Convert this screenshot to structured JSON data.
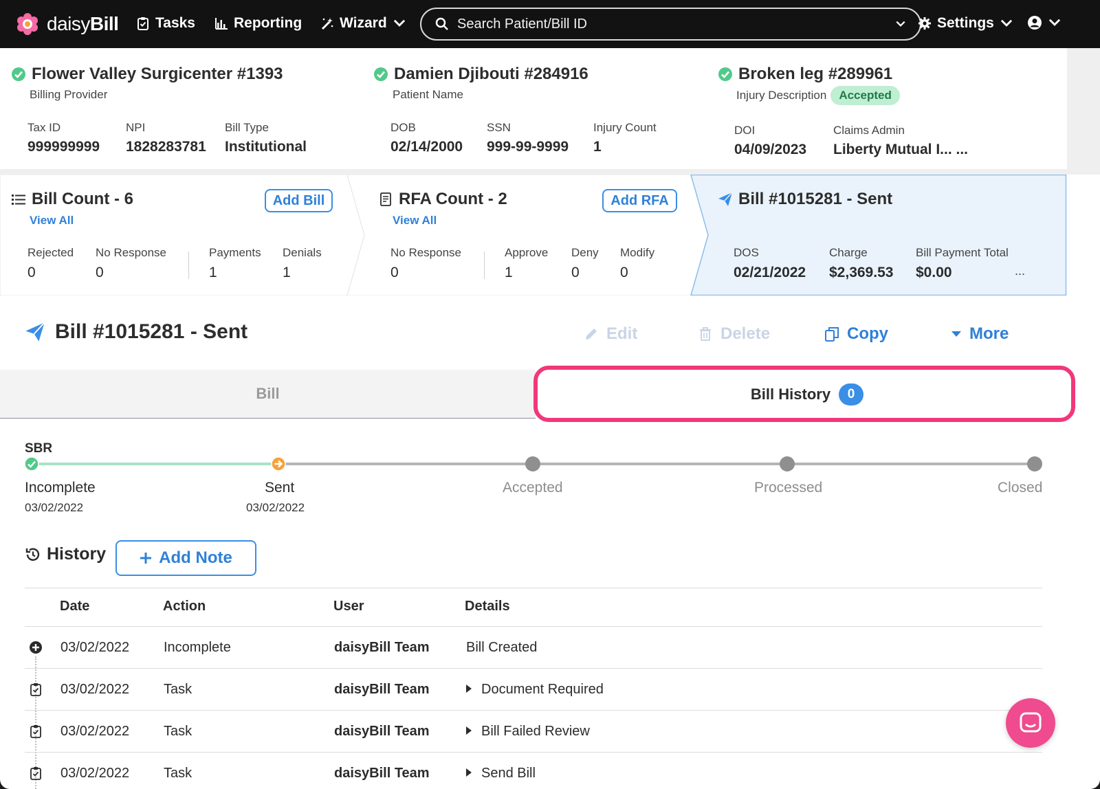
{
  "nav": {
    "brand_light": "daisy",
    "brand_bold": "Bill",
    "tasks": "Tasks",
    "reporting": "Reporting",
    "wizard": "Wizard",
    "search_placeholder": "Search Patient/Bill ID",
    "settings": "Settings"
  },
  "provider": {
    "title": "Flower Valley Surgicenter #1393",
    "subtitle": "Billing Provider",
    "fields": [
      {
        "label": "Tax ID",
        "value": "999999999"
      },
      {
        "label": "NPI",
        "value": "1828283781"
      },
      {
        "label": "Bill Type",
        "value": "Institutional"
      }
    ]
  },
  "patient": {
    "title": "Damien Djibouti #284916",
    "subtitle": "Patient Name",
    "fields": [
      {
        "label": "DOB",
        "value": "02/14/2000"
      },
      {
        "label": "SSN",
        "value": "999-99-9999"
      },
      {
        "label": "Injury Count",
        "value": "1"
      }
    ]
  },
  "injury": {
    "title": "Broken leg #289961",
    "subtitle": "Injury Description",
    "status": "Accepted",
    "fields": [
      {
        "label": "DOI",
        "value": "04/09/2023"
      },
      {
        "label": "Claims Admin",
        "value": "Liberty Mutual I... ..."
      }
    ]
  },
  "bills": {
    "title": "Bill Count - 6",
    "add_label": "Add Bill",
    "view_all": "View All",
    "fields": [
      {
        "label": "Rejected",
        "value": "0"
      },
      {
        "label": "No Response",
        "value": "0"
      },
      {
        "label": "Payments",
        "value": "1"
      },
      {
        "label": "Denials",
        "value": "1"
      }
    ]
  },
  "rfas": {
    "title": "RFA Count - 2",
    "add_label": "Add RFA",
    "view_all": "View All",
    "fields": [
      {
        "label": "No Response",
        "value": "0"
      },
      {
        "label": "Approve",
        "value": "1"
      },
      {
        "label": "Deny",
        "value": "0"
      },
      {
        "label": "Modify",
        "value": "0"
      }
    ]
  },
  "current_bill_card": {
    "title": "Bill #1015281 - Sent",
    "fields": [
      {
        "label": "DOS",
        "value": "02/21/2022"
      },
      {
        "label": "Charge",
        "value": "$2,369.53"
      },
      {
        "label": "Bill Payment Total",
        "value": "$0.00"
      }
    ],
    "overflow": "..."
  },
  "bill_header": {
    "title": "Bill #1015281 - Sent",
    "edit": "Edit",
    "delete": "Delete",
    "copy": "Copy",
    "more": "More"
  },
  "tabs": {
    "bill": "Bill",
    "history": "Bill History",
    "history_count": "0"
  },
  "progress": {
    "label": "SBR",
    "steps": [
      {
        "name": "Incomplete",
        "date": "03/02/2022",
        "state": "done"
      },
      {
        "name": "Sent",
        "date": "03/02/2022",
        "state": "current"
      },
      {
        "name": "Accepted",
        "date": "",
        "state": "pending"
      },
      {
        "name": "Processed",
        "date": "",
        "state": "pending"
      },
      {
        "name": "Closed",
        "date": "",
        "state": "pending"
      }
    ],
    "colors": {
      "done": "#52c98a",
      "current": "#f5a23a",
      "pending": "#8f8f8f",
      "track_done": "#a8e3c4",
      "track_pending": "#b5b5b5"
    }
  },
  "history": {
    "title": "History",
    "add_note": "Add Note",
    "columns": [
      "Date",
      "Action",
      "User",
      "Details"
    ],
    "rows": [
      {
        "icon": "plus-circle-icon",
        "date": "03/02/2022",
        "action": "Incomplete",
        "user": "daisyBill Team",
        "details": "Bill Created",
        "expandable": false
      },
      {
        "icon": "task-icon",
        "date": "03/02/2022",
        "action": "Task",
        "user": "daisyBill Team",
        "details": "Document Required",
        "expandable": true
      },
      {
        "icon": "task-icon",
        "date": "03/02/2022",
        "action": "Task",
        "user": "daisyBill Team",
        "details": "Bill Failed Review",
        "expandable": true
      },
      {
        "icon": "task-icon",
        "date": "03/02/2022",
        "action": "Task",
        "user": "daisyBill Team",
        "details": "Send Bill",
        "expandable": true
      }
    ]
  },
  "colors": {
    "accent": "#2f80d8",
    "highlight": "#f0387a",
    "success": "#52c98a",
    "nav_bg": "#121212"
  }
}
